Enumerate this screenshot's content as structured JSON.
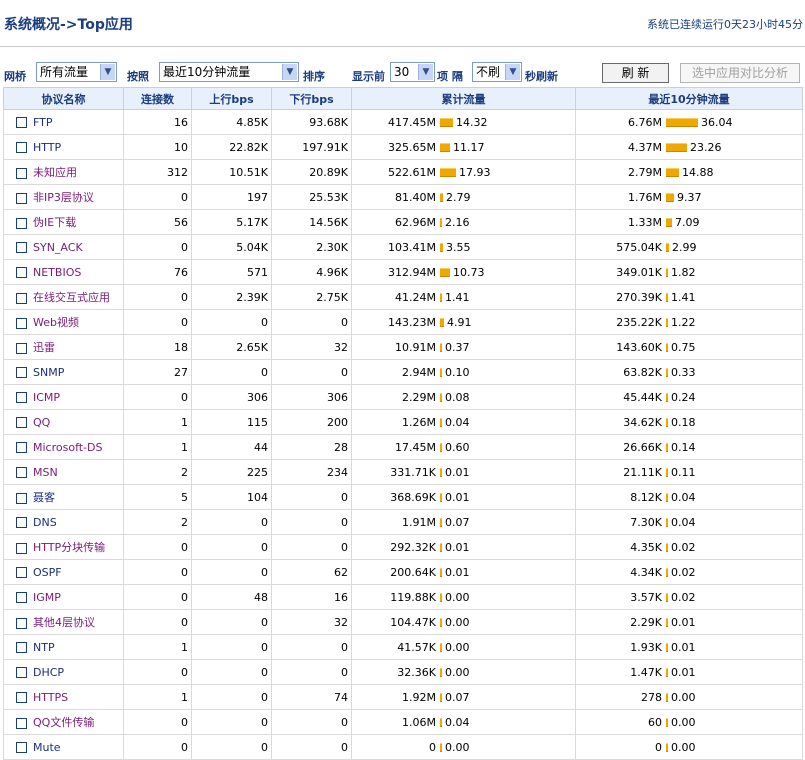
{
  "header": {
    "title": "系统概况->Top应用",
    "uptime": "系统已连续运行0天23小时45分"
  },
  "toolbar": {
    "bridge_label": "网桥",
    "bridge_value": "所有流量",
    "by_label": "按照",
    "sort_value": "最近10分钟流量",
    "sort_label": "排序",
    "show_label": "显示前",
    "show_value": "30",
    "items_label": "项 隔",
    "refresh_value": "不刷",
    "refresh_suffix": "秒刷新",
    "refresh_button": "刷 新",
    "compare_button": "选中应用对比分析"
  },
  "table": {
    "columns": [
      "协议名称",
      "连接数",
      "上行bps",
      "下行bps",
      "累计流量",
      "最近10分钟流量"
    ],
    "rows": [
      {
        "name": "FTP",
        "conn": "16",
        "up": "4.85K",
        "down": "93.68K",
        "total": "417.45M",
        "total_pct": "14.32",
        "recent": "6.76M",
        "recent_pct": "36.04",
        "blue": true
      },
      {
        "name": "HTTP",
        "conn": "10",
        "up": "22.82K",
        "down": "197.91K",
        "total": "325.65M",
        "total_pct": "11.17",
        "recent": "4.37M",
        "recent_pct": "23.26",
        "blue": true
      },
      {
        "name": "未知应用",
        "conn": "312",
        "up": "10.51K",
        "down": "20.89K",
        "total": "522.61M",
        "total_pct": "17.93",
        "recent": "2.79M",
        "recent_pct": "14.88",
        "blue": false
      },
      {
        "name": "非IP3层协议",
        "conn": "0",
        "up": "197",
        "down": "25.53K",
        "total": "81.40M",
        "total_pct": "2.79",
        "recent": "1.76M",
        "recent_pct": "9.37",
        "blue": false
      },
      {
        "name": "伪IE下载",
        "conn": "56",
        "up": "5.17K",
        "down": "14.56K",
        "total": "62.96M",
        "total_pct": "2.16",
        "recent": "1.33M",
        "recent_pct": "7.09",
        "blue": false
      },
      {
        "name": "SYN_ACK",
        "conn": "0",
        "up": "5.04K",
        "down": "2.30K",
        "total": "103.41M",
        "total_pct": "3.55",
        "recent": "575.04K",
        "recent_pct": "2.99",
        "blue": false
      },
      {
        "name": "NETBIOS",
        "conn": "76",
        "up": "571",
        "down": "4.96K",
        "total": "312.94M",
        "total_pct": "10.73",
        "recent": "349.01K",
        "recent_pct": "1.82",
        "blue": false
      },
      {
        "name": "在线交互式应用",
        "conn": "0",
        "up": "2.39K",
        "down": "2.75K",
        "total": "41.24M",
        "total_pct": "1.41",
        "recent": "270.39K",
        "recent_pct": "1.41",
        "blue": false
      },
      {
        "name": "Web视频",
        "conn": "0",
        "up": "0",
        "down": "0",
        "total": "143.23M",
        "total_pct": "4.91",
        "recent": "235.22K",
        "recent_pct": "1.22",
        "blue": false
      },
      {
        "name": "迅雷",
        "conn": "18",
        "up": "2.65K",
        "down": "32",
        "total": "10.91M",
        "total_pct": "0.37",
        "recent": "143.60K",
        "recent_pct": "0.75",
        "blue": false
      },
      {
        "name": "SNMP",
        "conn": "27",
        "up": "0",
        "down": "0",
        "total": "2.94M",
        "total_pct": "0.10",
        "recent": "63.82K",
        "recent_pct": "0.33",
        "blue": true
      },
      {
        "name": "ICMP",
        "conn": "0",
        "up": "306",
        "down": "306",
        "total": "2.29M",
        "total_pct": "0.08",
        "recent": "45.44K",
        "recent_pct": "0.24",
        "blue": false
      },
      {
        "name": "QQ",
        "conn": "1",
        "up": "115",
        "down": "200",
        "total": "1.26M",
        "total_pct": "0.04",
        "recent": "34.62K",
        "recent_pct": "0.18",
        "blue": false
      },
      {
        "name": "Microsoft-DS",
        "conn": "1",
        "up": "44",
        "down": "28",
        "total": "17.45M",
        "total_pct": "0.60",
        "recent": "26.66K",
        "recent_pct": "0.14",
        "blue": false
      },
      {
        "name": "MSN",
        "conn": "2",
        "up": "225",
        "down": "234",
        "total": "331.71K",
        "total_pct": "0.01",
        "recent": "21.11K",
        "recent_pct": "0.11",
        "blue": false
      },
      {
        "name": "聂客",
        "conn": "5",
        "up": "104",
        "down": "0",
        "total": "368.69K",
        "total_pct": "0.01",
        "recent": "8.12K",
        "recent_pct": "0.04",
        "blue": true
      },
      {
        "name": "DNS",
        "conn": "2",
        "up": "0",
        "down": "0",
        "total": "1.91M",
        "total_pct": "0.07",
        "recent": "7.30K",
        "recent_pct": "0.04",
        "blue": true
      },
      {
        "name": "HTTP分块传输",
        "conn": "0",
        "up": "0",
        "down": "0",
        "total": "292.32K",
        "total_pct": "0.01",
        "recent": "4.35K",
        "recent_pct": "0.02",
        "blue": false
      },
      {
        "name": "OSPF",
        "conn": "0",
        "up": "0",
        "down": "62",
        "total": "200.64K",
        "total_pct": "0.01",
        "recent": "4.34K",
        "recent_pct": "0.02",
        "blue": true
      },
      {
        "name": "IGMP",
        "conn": "0",
        "up": "48",
        "down": "16",
        "total": "119.88K",
        "total_pct": "0.00",
        "recent": "3.57K",
        "recent_pct": "0.02",
        "blue": false
      },
      {
        "name": "其他4层协议",
        "conn": "0",
        "up": "0",
        "down": "32",
        "total": "104.47K",
        "total_pct": "0.00",
        "recent": "2.29K",
        "recent_pct": "0.01",
        "blue": false
      },
      {
        "name": "NTP",
        "conn": "1",
        "up": "0",
        "down": "0",
        "total": "41.57K",
        "total_pct": "0.00",
        "recent": "1.93K",
        "recent_pct": "0.01",
        "blue": true
      },
      {
        "name": "DHCP",
        "conn": "0",
        "up": "0",
        "down": "0",
        "total": "32.36K",
        "total_pct": "0.00",
        "recent": "1.47K",
        "recent_pct": "0.01",
        "blue": true
      },
      {
        "name": "HTTPS",
        "conn": "1",
        "up": "0",
        "down": "74",
        "total": "1.92M",
        "total_pct": "0.07",
        "recent": "278",
        "recent_pct": "0.00",
        "blue": false
      },
      {
        "name": "QQ文件传输",
        "conn": "0",
        "up": "0",
        "down": "0",
        "total": "1.06M",
        "total_pct": "0.04",
        "recent": "60",
        "recent_pct": "0.00",
        "blue": false
      },
      {
        "name": "Mute",
        "conn": "0",
        "up": "0",
        "down": "0",
        "total": "0",
        "total_pct": "0.00",
        "recent": "0",
        "recent_pct": "0.00",
        "blue": true
      }
    ]
  },
  "colors": {
    "accent": "#1a3d80",
    "bar": "#f0a800",
    "header_bg": "#e8f0fb",
    "name_purple": "#7a1a78"
  }
}
